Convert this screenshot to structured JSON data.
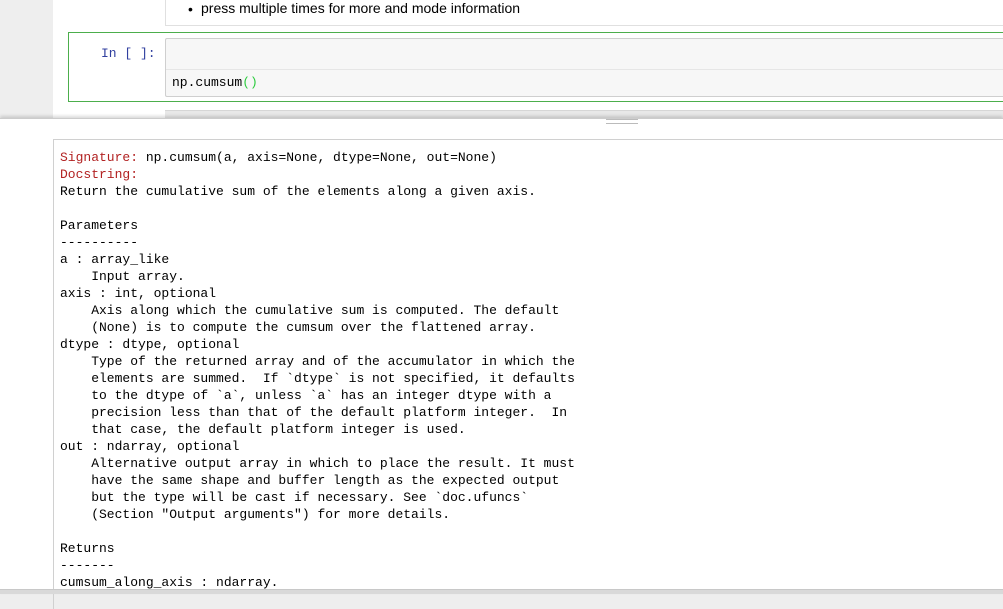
{
  "markdown_cell": {
    "bullet_char": "•",
    "bullet_text": "press multiple times for more and mode information"
  },
  "code_cell": {
    "prompt": "In [ ]:",
    "code_prefix": "np.cumsum",
    "code_parens": "()"
  },
  "pager": {
    "signature_label": "Signature:",
    "signature_value": " np.cumsum(a, axis=None, dtype=None, out=None)",
    "docstring_label": "Docstring:",
    "docstring_lines": [
      "Return the cumulative sum of the elements along a given axis.",
      "",
      "Parameters",
      "----------",
      "a : array_like",
      "    Input array.",
      "axis : int, optional",
      "    Axis along which the cumulative sum is computed. The default",
      "    (None) is to compute the cumsum over the flattened array.",
      "dtype : dtype, optional",
      "    Type of the returned array and of the accumulator in which the",
      "    elements are summed.  If `dtype` is not specified, it defaults",
      "    to the dtype of `a`, unless `a` has an integer dtype with a",
      "    precision less than that of the default platform integer.  In",
      "    that case, the default platform integer is used.",
      "out : ndarray, optional",
      "    Alternative output array in which to place the result. It must",
      "    have the same shape and buffer length as the expected output",
      "    but the type will be cast if necessary. See `doc.ufuncs`",
      "    (Section \"Output arguments\") for more details.",
      "",
      "Returns",
      "-------",
      "cumsum_along_axis : ndarray."
    ]
  },
  "colors": {
    "prompt_blue": "#303f9f",
    "selected_cell_border": "#4cae4c",
    "paren_green": "#2ecc40",
    "doc_header_red": "#b22222"
  }
}
